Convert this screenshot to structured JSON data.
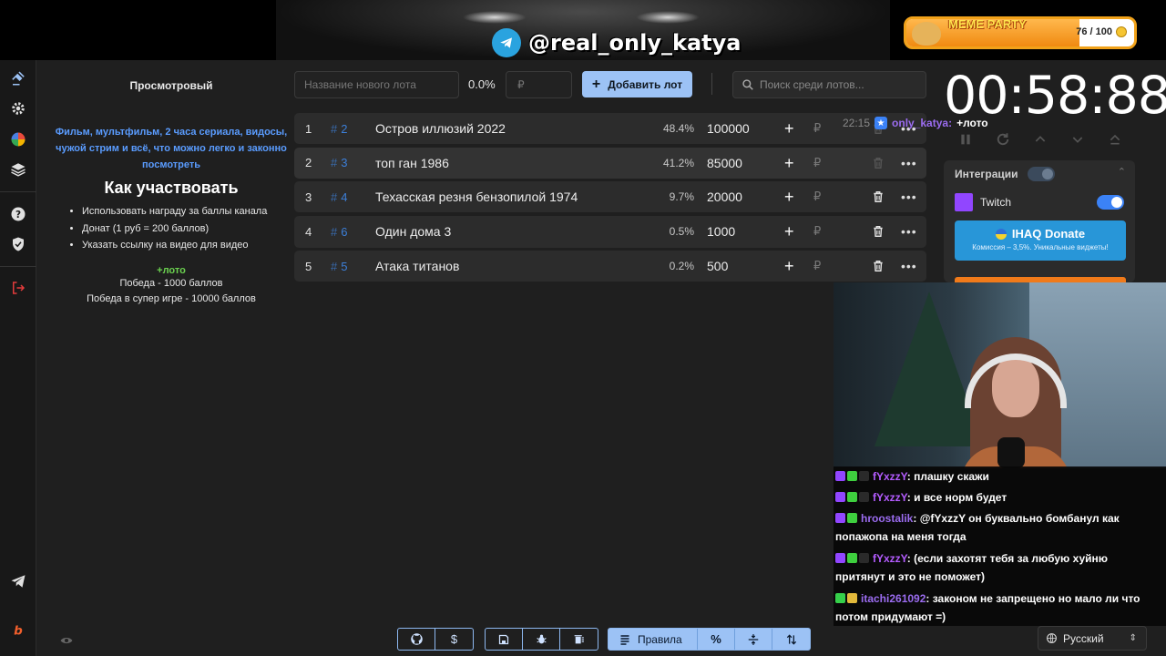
{
  "overlay": {
    "handle": "@real_only_katya",
    "meme_party": {
      "title": "MEME PARTY",
      "current": 76,
      "max": 100,
      "count_text": "76 / 100"
    }
  },
  "sidebar": {
    "icons": [
      "gavel-icon",
      "gear-icon",
      "pie-chart-icon",
      "layers-icon",
      "help-icon",
      "shield-icon",
      "logout-icon",
      "telegram-icon",
      "boosty-icon"
    ]
  },
  "info": {
    "subtitle": "Просмотровый",
    "description": "Фильм, мультфильм, 2 часа сериала, видосы, чужой стрим и всё, что можно легко и законно посмотреть",
    "how_title": "Как участвовать",
    "rules": [
      "Использовать награду за баллы канала",
      "Донат (1 руб = 200 баллов)",
      "Указать ссылку на видео для видео"
    ],
    "command": "+лото",
    "prizes": [
      "Победа - 1000 баллов",
      "Победа в супер игре - 10000 баллов"
    ]
  },
  "controls": {
    "lot_name_placeholder": "Название нового лота",
    "percent": "0.0%",
    "amount_placeholder": "₽",
    "add_label": "Добавить лот",
    "search_placeholder": "Поиск среди лотов..."
  },
  "lots": [
    {
      "index": "1",
      "id": "2",
      "name": "Остров иллюзий 2022",
      "share": "48.4%",
      "sum": "100000",
      "currency": "₽"
    },
    {
      "index": "2",
      "id": "3",
      "name": "топ ган 1986",
      "share": "41.2%",
      "sum": "85000",
      "currency": "₽"
    },
    {
      "index": "3",
      "id": "4",
      "name": "Техасская резня бензопилой 1974",
      "share": "9.7%",
      "sum": "20000",
      "currency": "₽"
    },
    {
      "index": "4",
      "id": "6",
      "name": "Один дома 3",
      "share": "0.5%",
      "sum": "1000",
      "currency": "₽"
    },
    {
      "index": "5",
      "id": "5",
      "name": "Атака титанов",
      "share": "0.2%",
      "sum": "500",
      "currency": "₽"
    }
  ],
  "timer": {
    "value": "00:58:88"
  },
  "top_chat": {
    "time": "22:15",
    "user": "only_katya:",
    "message": "+лото"
  },
  "integrations": {
    "title": "Интеграции",
    "twitch_label": "Twitch",
    "donate_title": "IHAQ Donate",
    "donate_sub": "Комиссия – 3,5%. Уникальные виджеты!"
  },
  "chat": [
    {
      "user": "fYxzzY",
      "user_color": "#b45cff",
      "text": ": плашку скажи",
      "badges": [
        "#9146ff",
        "#3ecf3e",
        "#2a2a2a"
      ]
    },
    {
      "user": "fYxzzY",
      "user_color": "#b45cff",
      "text": ": и все норм будет",
      "badges": [
        "#9146ff",
        "#3ecf3e",
        "#2a2a2a"
      ]
    },
    {
      "user": "hroostalik",
      "user_color": "#9b6cf0",
      "text": ": @fYxzzY он буквально бомбанул как попажопа на меня тогда",
      "badges": [
        "#9146ff",
        "#3ecf3e"
      ]
    },
    {
      "user": "fYxzzY",
      "user_color": "#b45cff",
      "text": ": (если захотят тебя за любую хуйню притянут и это не поможет)",
      "badges": [
        "#9146ff",
        "#3ecf3e",
        "#2a2a2a"
      ]
    },
    {
      "user": "itachi261092",
      "user_color": "#9b6cf0",
      "text": ": законом не запрещено но мало ли что потом придумают =)",
      "badges": [
        "#35d04a",
        "#e2b93b"
      ]
    }
  ],
  "language": {
    "selected": "Русский"
  },
  "toolbar": {
    "rules_label": "Правила"
  },
  "colors": {
    "accent": "#9cc2f5",
    "link": "#3c7fd8",
    "desc": "#5a9cff",
    "green": "#6bd14f"
  }
}
